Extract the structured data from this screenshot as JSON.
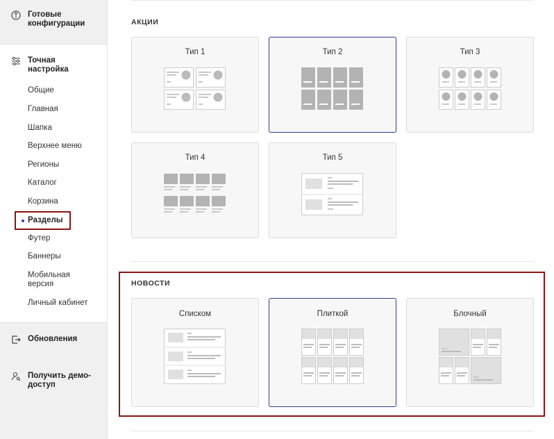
{
  "sidebar": {
    "ready_configs": "Готовые конфигурации",
    "fine_tuning": "Точная настройка",
    "items": [
      "Общие",
      "Главная",
      "Шапка",
      "Верхнее меню",
      "Регионы",
      "Каталог",
      "Корзина",
      "Разделы",
      "Футер",
      "Баннеры",
      "Мобильная версия",
      "Личный кабинет"
    ],
    "active_item": "Разделы",
    "updates": "Обновления",
    "demo_access": "Получить демо-доступ"
  },
  "sections": {
    "promo": {
      "title": "АКЦИИ",
      "cards": [
        {
          "label": "Тип 1",
          "selected": false
        },
        {
          "label": "Тип 2",
          "selected": true
        },
        {
          "label": "Тип 3",
          "selected": false
        },
        {
          "label": "Тип 4",
          "selected": false
        },
        {
          "label": "Тип 5",
          "selected": false
        }
      ]
    },
    "news": {
      "title": "НОВОСТИ",
      "cards": [
        {
          "label": "Списком",
          "selected": false
        },
        {
          "label": "Плиткой",
          "selected": true
        },
        {
          "label": "Блочный",
          "selected": false
        }
      ]
    }
  },
  "colors": {
    "accent": "#2e3f8f",
    "highlight": "#8b1414",
    "active_dot": "#2b3fc2"
  }
}
